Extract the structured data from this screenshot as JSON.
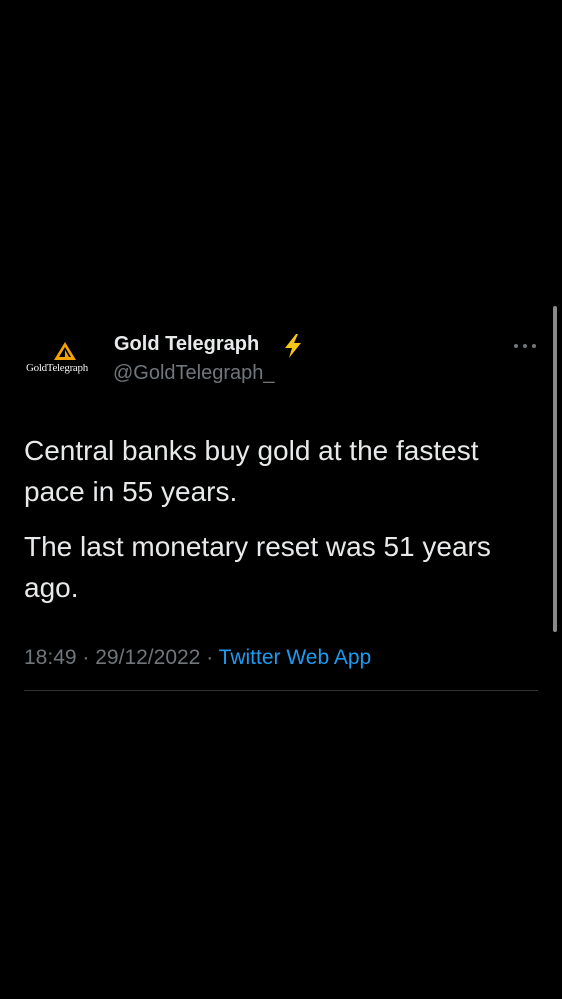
{
  "colors": {
    "background": "#000000",
    "primary_text": "#e7e9ea",
    "secondary_text": "#71767b",
    "link": "#1d9bf0",
    "divider": "#2f3336",
    "verified_bolt": "#f5c518",
    "logo_gold": "#f4a300"
  },
  "tweet": {
    "author": {
      "display_name": "Gold Telegraph",
      "verified_icon": "lightning-bolt-icon",
      "handle": "@GoldTelegraph_",
      "avatar": {
        "icon": "gold-telegraph-logo-icon",
        "logo_text": "GoldTelegraph"
      }
    },
    "more_icon": "more-options-icon",
    "paragraphs": [
      "Central banks buy gold at the fastest pace in 55 years.",
      "The last monetary reset was 51 years ago."
    ],
    "meta": {
      "time": "18:49",
      "separator": "·",
      "date": "29/12/2022",
      "source": "Twitter Web App"
    }
  }
}
